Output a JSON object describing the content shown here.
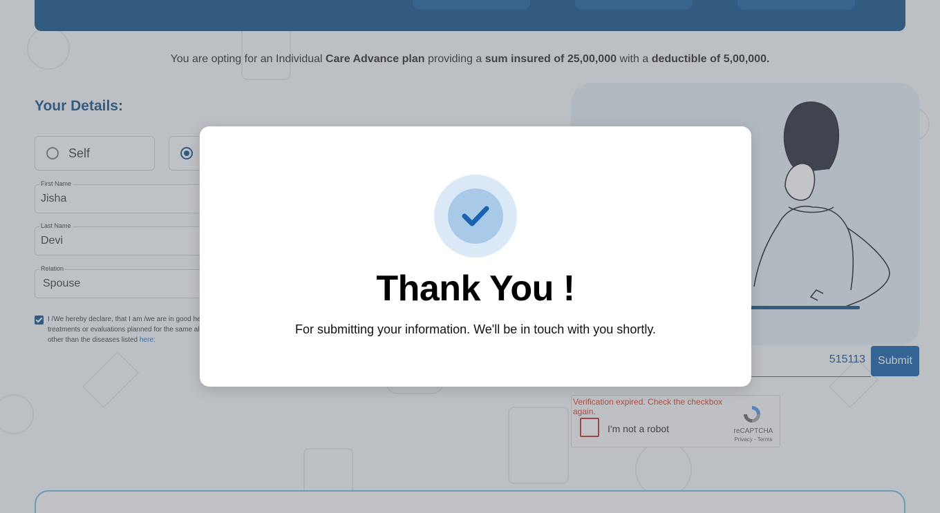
{
  "plan": {
    "prefix": "You are opting for an Individual ",
    "plan_name": "Care Advance plan",
    "mid1": " providing a ",
    "sum_insured": "sum insured of 25,00,000",
    "mid2": " with a ",
    "deductible": "deductible of 5,00,000."
  },
  "details": {
    "title": "Your Details:",
    "relation_options": [
      {
        "label": "Self",
        "selected": false
      },
      {
        "label": "",
        "selected": true
      }
    ],
    "first_name": {
      "label": "First Name",
      "value": "Jisha"
    },
    "last_name": {
      "label": "Last Name",
      "value": "Devi"
    },
    "relation": {
      "label": "Relation",
      "value": "Spouse"
    },
    "declaration": {
      "line1": "I /We hereby declare, that I am /we are in good hea",
      "line2": "treatments or evaluations planned for the same al",
      "line3": "other than the diseases listed ",
      "link": "here:"
    }
  },
  "contact": {
    "phone_value": "515113",
    "submit_label": "Submit"
  },
  "recaptcha": {
    "error": "Verification expired. Check the checkbox again.",
    "label": "I'm not a robot",
    "brand": "reCAPTCHA",
    "links": "Privacy - Terms"
  },
  "modal": {
    "title": "Thank You !",
    "subtitle": "For submitting your information. We'll be in touch with you shortly.",
    "icon": "check-icon"
  },
  "colors": {
    "brand": "#0a4a86",
    "accent": "#0a5aa8",
    "error": "#d93025"
  }
}
